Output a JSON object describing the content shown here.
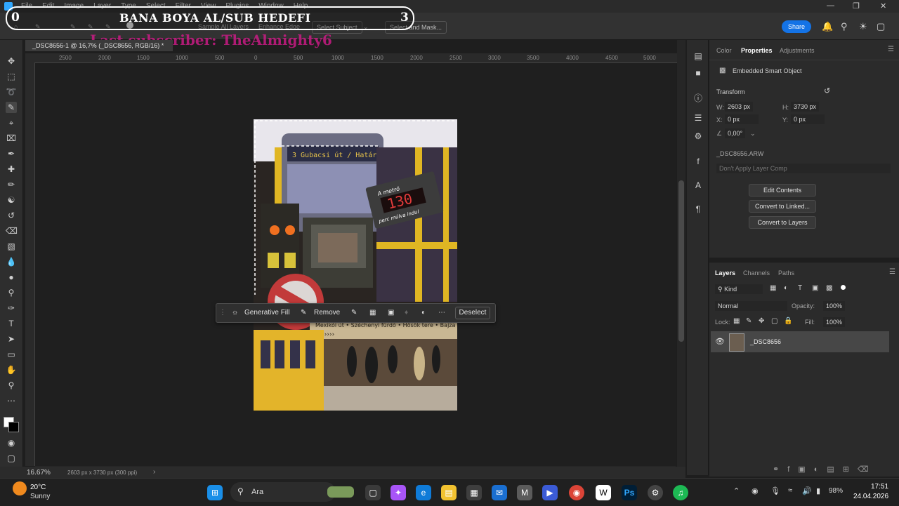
{
  "menubar": {
    "items": [
      "File",
      "Edit",
      "Image",
      "Layer",
      "Type",
      "Select",
      "Filter",
      "View",
      "Plugins",
      "Window",
      "Help"
    ]
  },
  "overlay": {
    "left_number": "0",
    "title": "BANA BOYA AL/SUB HEDEFI",
    "right_number": "3",
    "subscriber_text": "Last subscriber: TheAlmighty6"
  },
  "options_bar": {
    "sample_all_layers": "Sample All Layers",
    "enhance_edge": "Enhance Edge",
    "select_subject": "Select Subject",
    "select_and_mask": "Select and Mask...",
    "share": "Share"
  },
  "document": {
    "tab_title": "_DSC8656-1 @ 16,7% (_DSC8656, RGB/16) *",
    "ruler_marks": [
      "2500",
      "2000",
      "1500",
      "1000",
      "500",
      "0",
      "500",
      "1000",
      "1500",
      "2000",
      "2500",
      "3000",
      "3500",
      "4000",
      "4500",
      "5000"
    ]
  },
  "image_text": {
    "bus_display": "3 Gubacsi út / Határ út",
    "sign_title": "A metró",
    "sign_value": "130",
    "sign_sub": "perc múlva indul",
    "station_sign": "Mexikói út • Széchenyi fürdő • Hősök tere • Bajza"
  },
  "context_bar": {
    "generative_fill": "Generative Fill",
    "remove": "Remove",
    "deselect": "Deselect"
  },
  "status": {
    "zoom": "16.67%",
    "dims": "2603 px x 3730 px (300 ppi)"
  },
  "properties": {
    "tabs": [
      "Color",
      "Properties",
      "Adjustments"
    ],
    "object_type": "Embedded Smart Object",
    "transform_label": "Transform",
    "w_label": "W:",
    "w_value": "2603 px",
    "h_label": "H:",
    "h_value": "3730 px",
    "x_label": "X:",
    "x_value": "0 px",
    "y_label": "Y:",
    "y_value": "0 px",
    "angle_value": "0,00°",
    "file_name": "_DSC8656.ARW",
    "layer_comp": "Don't Apply Layer Comp",
    "buttons": [
      "Edit Contents",
      "Convert to Linked...",
      "Convert to Layers"
    ]
  },
  "layers": {
    "tabs": [
      "Layers",
      "Channels",
      "Paths"
    ],
    "filter": "Kind",
    "blend_mode": "Normal",
    "opacity_label": "Opacity:",
    "opacity_value": "100%",
    "lock_label": "Lock:",
    "fill_label": "Fill:",
    "fill_value": "100%",
    "layer_name": "_DSC8656"
  },
  "taskbar": {
    "weather_temp": "20°C",
    "weather_desc": "Sunny",
    "search": "Ara",
    "battery": "98%",
    "time": "17:51",
    "date": "24.04.2026"
  }
}
